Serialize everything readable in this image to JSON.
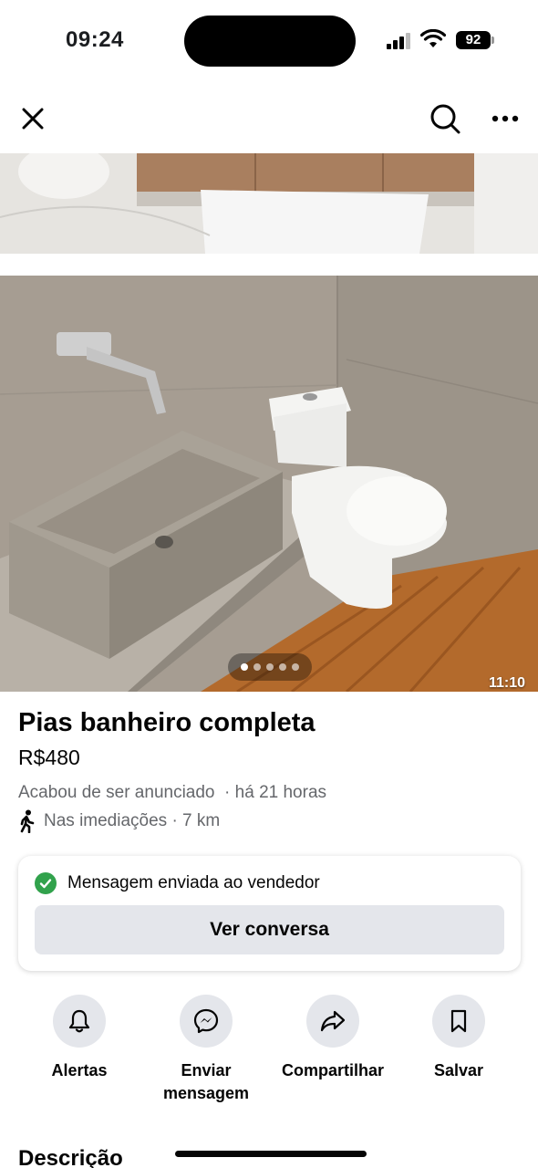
{
  "status_bar": {
    "time": "09:24",
    "battery": "92"
  },
  "nav": {
    "close_icon": "close-icon",
    "search_icon": "search-icon",
    "more_icon": "more-icon"
  },
  "media": {
    "carousel_count": 5,
    "carousel_active_index": 0,
    "video_duration": "11:10"
  },
  "listing": {
    "title": "Pias banheiro completa",
    "price": "R$480",
    "listed_time": "Acabou de ser anunciado  · há 21 horas",
    "location": "Nas imediações · 7 km",
    "location_icon": "walking-person-icon"
  },
  "message_card": {
    "status_text": "Mensagem enviada ao vendedor",
    "status_color": "#31a24c",
    "button_label": "Ver conversa"
  },
  "actions": [
    {
      "label": "Alertas",
      "icon": "bell-icon"
    },
    {
      "label": "Enviar\nmensagem",
      "icon": "messenger-icon"
    },
    {
      "label": "Compartilhar",
      "icon": "share-icon"
    },
    {
      "label": "Salvar",
      "icon": "bookmark-icon"
    }
  ],
  "description": {
    "heading": "Descrição"
  }
}
